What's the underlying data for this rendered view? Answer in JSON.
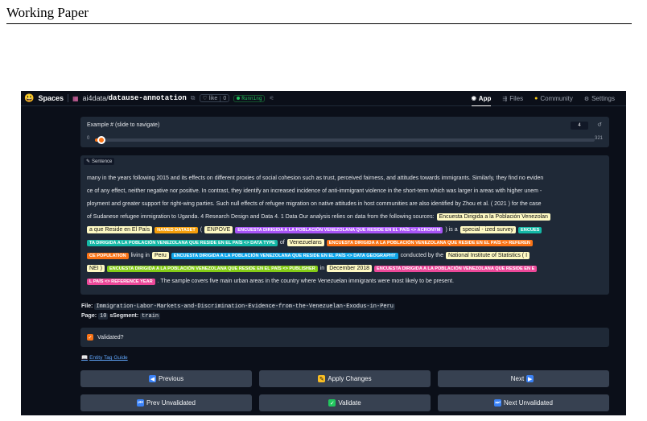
{
  "paper": {
    "header": "Working Paper"
  },
  "topbar": {
    "spaces_label": "Spaces",
    "repo_owner": "ai4data/",
    "repo_name": "datause-annotation",
    "like_label": "like",
    "like_count": "0",
    "status": "Running",
    "tabs": [
      {
        "label": "App",
        "icon": "app-icon"
      },
      {
        "label": "Files",
        "icon": "files-icon"
      },
      {
        "label": "Community",
        "icon": "community-icon"
      },
      {
        "label": "Settings",
        "icon": "gear-icon"
      }
    ]
  },
  "example": {
    "label": "Example # (slide to navigate)",
    "value": "4",
    "min": "0",
    "max": "321",
    "fraction": 0.0125
  },
  "sentence": {
    "tag_label": "Sentence",
    "lines": [
      [
        {
          "t": "tx",
          "v": "many in the years following 2015 and its effects on different proxies of social cohesion such as trust, perceived fairness, and attitudes towards immigrants. Similarly, they find no eviden"
        }
      ],
      [
        {
          "t": "tx",
          "v": "ce of any effect, neither negative nor positive. In contrast, they identify an increased incidence of anti-immigrant violence in the short-term which was larger in areas with higher unem -"
        }
      ],
      [
        {
          "t": "tx",
          "v": "ployment and greater support for right-wing parties. Such null effects of refugee migration on native attitudes in host communities are also identified by Zhou et al. ( 2021 ) for the case"
        }
      ],
      [
        {
          "t": "tx",
          "v": "of Sudanese refugee immigration to Uganda. 4 Research Design and Data 4. 1 Data Our analysis relies on data from the following sources:"
        },
        {
          "t": "ent",
          "v": "Encuesta Dirigida a la Población Venezolan"
        }
      ],
      [
        {
          "t": "ent",
          "v": "a que Reside en El País"
        },
        {
          "t": "lbl",
          "c": "named",
          "v": "NAMED DATASET"
        },
        {
          "t": "tx",
          "v": "("
        },
        {
          "t": "ent",
          "v": "ENPOVE"
        },
        {
          "t": "lbl",
          "c": "acronym",
          "v": "ENCUESTA DIRIGIDA A LA POBLACIÓN VENEZOLANA QUE RESIDE EN EL PAÍS <> ACRONYM"
        },
        {
          "t": "tx",
          "v": ") is a"
        },
        {
          "t": "ent",
          "v": "special - ized survey"
        },
        {
          "t": "lbl",
          "c": "dtype",
          "v": "ENCUES"
        }
      ],
      [
        {
          "t": "lbl",
          "c": "dtype",
          "v": "TA DIRIGIDA A LA POBLACIÓN VENEZOLANA QUE RESIDE EN EL PAÍS <> DATA TYPE"
        },
        {
          "t": "tx",
          "v": "of"
        },
        {
          "t": "ent",
          "v": "Venezuelans"
        },
        {
          "t": "lbl",
          "c": "reference",
          "v": "ENCUESTA DIRIGIDA A LA POBLACIÓN VENEZOLANA QUE RESIDE EN EL PAÍS <> REFEREN"
        }
      ],
      [
        {
          "t": "lbl",
          "c": "reference",
          "v": "CE POPULATION"
        },
        {
          "t": "tx",
          "v": "living in"
        },
        {
          "t": "ent",
          "v": "Peru"
        },
        {
          "t": "lbl",
          "c": "geography",
          "v": "ENCUESTA DIRIGIDA A LA POBLACIÓN VENEZOLANA QUE RESIDE EN EL PAÍS <> DATA GEOGRAPHY"
        },
        {
          "t": "tx",
          "v": "conducted by the"
        },
        {
          "t": "ent",
          "v": "National Institute of Statistics ( I"
        }
      ],
      [
        {
          "t": "ent",
          "v": "NEI )"
        },
        {
          "t": "lbl",
          "c": "publisher",
          "v": "ENCUESTA DIRIGIDA A LA POBLACIÓN VENEZOLANA QUE RESIDE EN EL PAÍS <> PUBLISHER"
        },
        {
          "t": "tx",
          "v": "in"
        },
        {
          "t": "ent",
          "v": "December 2018"
        },
        {
          "t": "lbl",
          "c": "refyear",
          "v": "ENCUESTA DIRIGIDA A LA POBLACIÓN VENEZOLANA QUE RESIDE EN E"
        }
      ],
      [
        {
          "t": "lbl",
          "c": "refyear",
          "v": "L PAÍS <> REFERENCE YEAR"
        },
        {
          "t": "tx",
          "v": ". The sample covers five main urban areas in the country where Venezuelan immigrants were most likely to be present."
        }
      ]
    ]
  },
  "file_info": {
    "file_label": "File:",
    "file_value": "Immigration-Labor-Markets-and-Discrimination-Evidence-from-the-Venezuelan-Exodus-in-Peru",
    "page_label": "Page:",
    "page_value": "10",
    "segment_label": "sSegment:",
    "segment_value": "train"
  },
  "validated": {
    "label": "Validated?",
    "checked": true
  },
  "guide_link": "Entity Tag Guide",
  "buttons": {
    "previous": "Previous",
    "apply": "Apply Changes",
    "next": "Next",
    "prev_unvalidated": "Prev Unvalidated",
    "validate": "Validate",
    "next_unvalidated": "Next Unvalidated"
  }
}
